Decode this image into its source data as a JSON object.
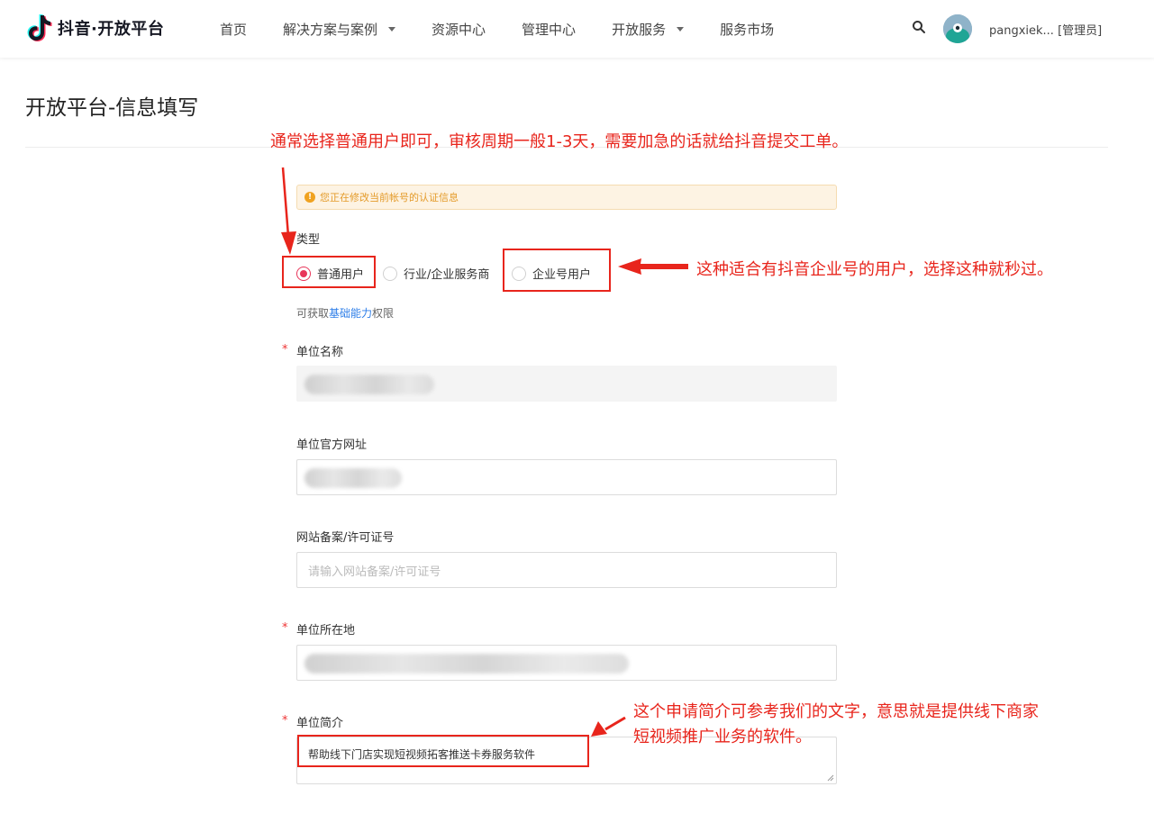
{
  "header": {
    "logo_text": "抖音·开放平台",
    "nav": [
      {
        "label": "首页",
        "has_dropdown": false
      },
      {
        "label": "解决方案与案例",
        "has_dropdown": true
      },
      {
        "label": "资源中心",
        "has_dropdown": false
      },
      {
        "label": "管理中心",
        "has_dropdown": false
      },
      {
        "label": "开放服务",
        "has_dropdown": true
      },
      {
        "label": "服务市场",
        "has_dropdown": false
      }
    ],
    "search_icon": "search-icon",
    "user": "pangxiek... [管理员]"
  },
  "page": {
    "title": "开放平台-信息填写"
  },
  "notice": {
    "text": "您正在修改当前帐号的认证信息",
    "icon": "exclamation-icon",
    "color": "#f0a21f"
  },
  "form": {
    "type_label": "类型",
    "type_options": [
      "普通用户",
      "行业/企业服务商",
      "企业号用户"
    ],
    "type_selected": "普通用户",
    "hint_prefix": "可获取",
    "hint_link": "基础能力",
    "hint_suffix": "权限",
    "required_mark": "*",
    "company_name_label": "单位名称",
    "website_label": "单位官方网址",
    "icp_label": "网站备案/许可证号",
    "icp_placeholder": "请输入网站备案/许可证号",
    "location_label": "单位所在地",
    "intro_label": "单位简介",
    "intro_value": "帮助线下门店实现短视频拓客推送卡券服务软件"
  },
  "annotations": {
    "top": "通常选择普通用户即可，审核周期一般1-3天，需要加急的话就给抖音提交工单。",
    "enterprise": "这种适合有抖音企业号的用户，选择这种就秒过。",
    "intro_line1": "这个申请简介可参考我们的文字，意思就是提供线下商家",
    "intro_line2": "短视频推广业务的软件。",
    "color": "#e8251c"
  },
  "colors": {
    "accent": "#e8365a",
    "link": "#2d7ee8"
  }
}
